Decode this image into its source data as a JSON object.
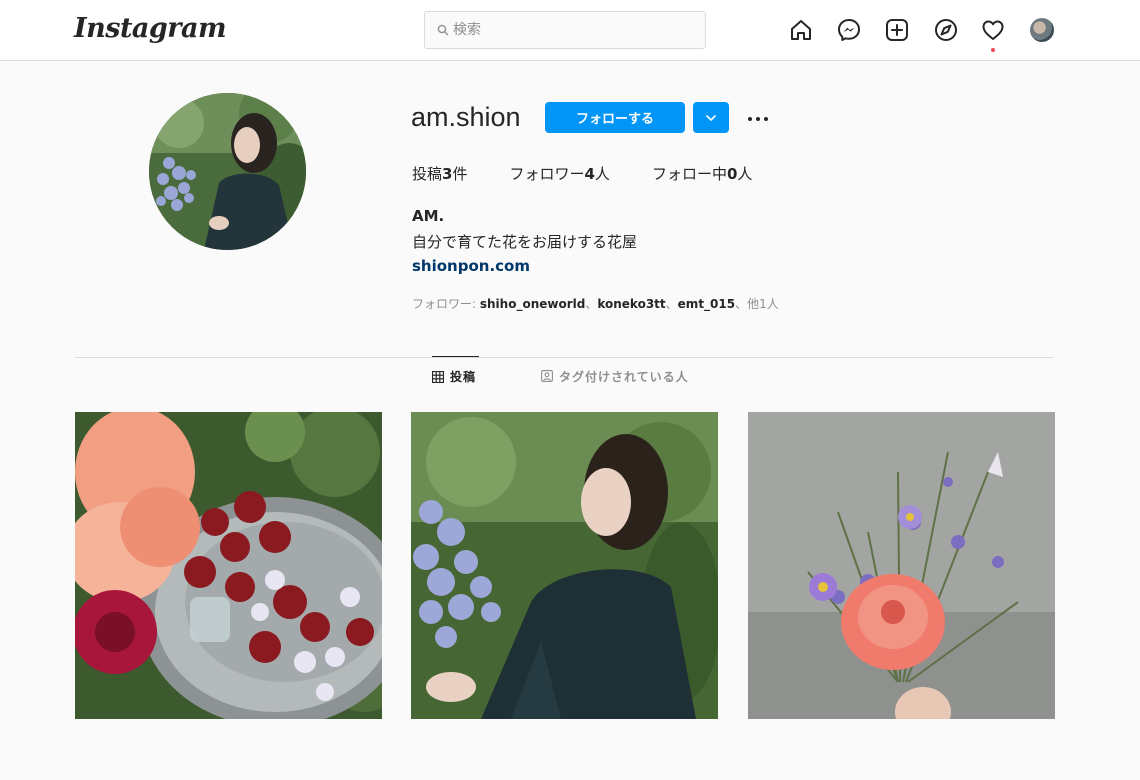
{
  "header": {
    "logo": "Instagram",
    "search": {
      "placeholder": "検索"
    },
    "nav_icons": [
      "home-icon",
      "messenger-icon",
      "new-post-icon",
      "explore-icon",
      "activity-heart-icon",
      "profile-avatar"
    ],
    "notification_dot_color": "#ed4956"
  },
  "profile": {
    "username": "am.shion",
    "follow_label": "フォローする",
    "stats": {
      "posts_label": "投稿",
      "posts_count": "3",
      "posts_unit": "件",
      "followers_label": "フォロワー",
      "followers_count": "4",
      "followers_unit": "人",
      "following_label": "フォロー中",
      "following_count": "0",
      "following_unit": "人"
    },
    "full_name": "AM.",
    "bio": "自分で育てた花をお届けする花屋",
    "website": "shionpon.com",
    "followed_by": {
      "prefix": "フォロワー: ",
      "users": [
        "shiho_oneworld",
        "koneko3tt",
        "emt_015"
      ],
      "separator": "、",
      "suffix": "、他1人"
    }
  },
  "tabs": [
    {
      "label": "投稿",
      "active": true
    },
    {
      "label": "タグ付けされている人",
      "active": false
    }
  ],
  "posts": [
    {
      "subject": "dahlias-in-metal-tub"
    },
    {
      "subject": "woman-holding-aster"
    },
    {
      "subject": "dahlia-bouquet-grey-wall"
    }
  ],
  "colors": {
    "accent": "#0095f6",
    "link": "#00376b",
    "text": "#262626",
    "muted": "#8e8e8e",
    "border": "#dbdbdb",
    "background": "#fafafa"
  }
}
